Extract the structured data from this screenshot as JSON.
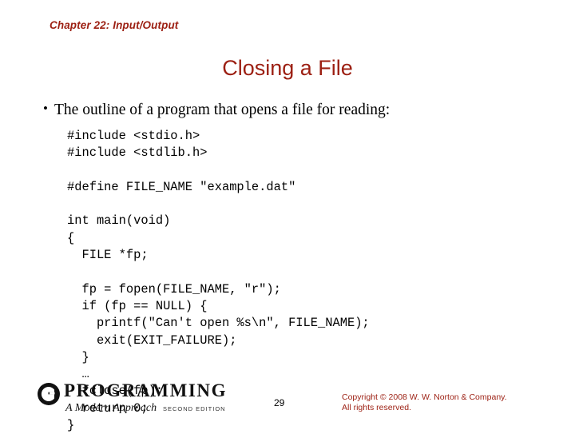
{
  "header": {
    "chapter": "Chapter 22: Input/Output"
  },
  "title": "Closing a File",
  "bullet": {
    "marker": "•",
    "text": "The outline of a program that opens a file for reading:"
  },
  "code_lines": [
    "#include <stdio.h>",
    "#include <stdlib.h>",
    "",
    "#define FILE_NAME \"example.dat\"",
    "",
    "int main(void)",
    "{",
    "  FILE *fp;",
    "",
    "  fp = fopen(FILE_NAME, \"r\");",
    "  if (fp == NULL) {",
    "    printf(\"Can't open %s\\n\", FILE_NAME);",
    "    exit(EXIT_FAILURE);",
    "  }",
    "  …",
    "  fclose(fp);",
    "  return 0;",
    "}"
  ],
  "footer": {
    "logo_main": "PROGRAMMING",
    "logo_sub": "A Modern Approach",
    "logo_edition": "SECOND EDITION",
    "page_number": "29",
    "copyright_line1": "Copyright © 2008 W. W. Norton & Company.",
    "copyright_line2": "All rights reserved."
  },
  "colors": {
    "accent": "#9c1f12",
    "text": "#000000",
    "background": "#ffffff"
  }
}
